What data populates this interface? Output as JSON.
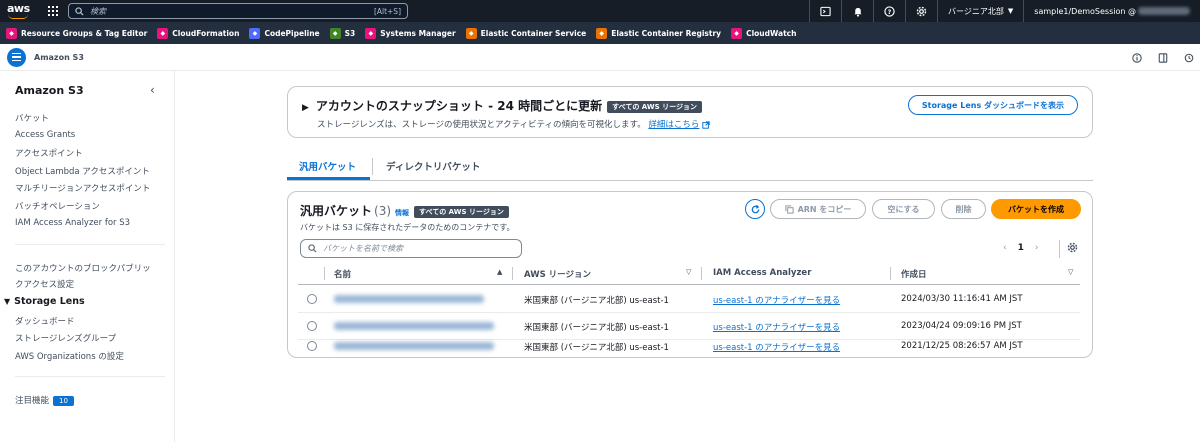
{
  "topnav": {
    "search_placeholder": "検索",
    "search_shortcut": "[Alt+S]",
    "region": "バージニア北部",
    "account": "sample1/DemoSession @"
  },
  "favorites": [
    {
      "label": "Resource Groups & Tag Editor",
      "color": "#e7157b"
    },
    {
      "label": "CloudFormation",
      "color": "#e7157b"
    },
    {
      "label": "CodePipeline",
      "color": "#4d6bfe"
    },
    {
      "label": "S3",
      "color": "#3f8624"
    },
    {
      "label": "Systems Manager",
      "color": "#e7157b"
    },
    {
      "label": "Elastic Container Service",
      "color": "#ed7100"
    },
    {
      "label": "Elastic Container Registry",
      "color": "#ed7100"
    },
    {
      "label": "CloudWatch",
      "color": "#e7157b"
    }
  ],
  "breadcrumb": "Amazon S3",
  "sidenav": {
    "title": "Amazon S3",
    "items": [
      "バケット",
      "Access Grants",
      "アクセスポイント",
      "Object Lambda アクセスポイント",
      "マルチリージョンアクセスポイント",
      "バッチオペレーション",
      "IAM Access Analyzer for S3"
    ],
    "block_access_1": "このアカウントのブロックパブリッ",
    "block_access_2": "クアクセス設定",
    "storage_lens": "Storage Lens",
    "lens_items": [
      "ダッシュボード",
      "ストレージレンズグループ",
      "AWS Organizations の設定"
    ],
    "featured": "注目機能",
    "featured_count": "10"
  },
  "snapshot": {
    "title": "アカウントのスナップショット - 24 時間ごとに更新",
    "tag": "すべての AWS リージョン",
    "desc": "ストレージレンズは、ストレージの使用状況とアクティビティの傾向を可視化します。",
    "link": "詳細はこちら",
    "button": "Storage Lens ダッシュボードを表示"
  },
  "tabs": {
    "general": "汎用バケット",
    "directory": "ディレクトリバケット"
  },
  "panel": {
    "title": "汎用バケット",
    "count": "(3)",
    "info": "情報",
    "tag": "すべての AWS リージョン",
    "desc": "バケットは S3 に保存されたデータのためのコンテナです。",
    "copy_arn": "ARN をコピー",
    "empty": "空にする",
    "delete": "削除",
    "create": "バケットを作成",
    "search_placeholder": "バケットを名前で検索",
    "page": "1"
  },
  "table": {
    "headers": {
      "name": "名前",
      "region": "AWS リージョン",
      "iam": "IAM Access Analyzer",
      "created": "作成日"
    },
    "rows": [
      {
        "region": "米国東部 (バージニア北部) us-east-1",
        "iam": "us-east-1 のアナライザーを見る",
        "created": "2024/03/30 11:16:41 AM JST"
      },
      {
        "region": "米国東部 (バージニア北部) us-east-1",
        "iam": "us-east-1 のアナライザーを見る",
        "created": "2023/04/24 09:09:16 PM JST"
      },
      {
        "region": "米国東部 (バージニア北部) us-east-1",
        "iam": "us-east-1 のアナライザーを見る",
        "created": "2021/12/25 08:26:57 AM JST"
      }
    ]
  }
}
